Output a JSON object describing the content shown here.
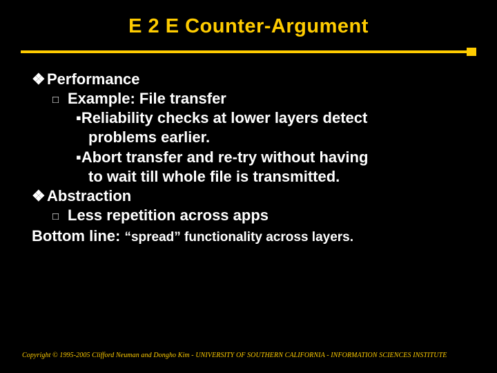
{
  "title": "E 2 E Counter-Argument",
  "items": {
    "performance": "Performance",
    "example": "Example: File transfer",
    "reliability1": "Reliability checks at lower layers detect",
    "reliability2": "problems earlier.",
    "abort1": "Abort transfer and re-try without having",
    "abort2": "to wait till whole file is transmitted.",
    "abstraction": "Abstraction",
    "less_rep": "Less repetition across apps"
  },
  "bottom": {
    "label": "Bottom line: ",
    "text": "“spread” functionality across layers."
  },
  "bullets": {
    "diamond": "❖",
    "square_outline": "□",
    "square_solid": "▪"
  },
  "copyright": "Copyright © 1995-2005 Clifford Neuman and Dongho Kim - UNIVERSITY OF SOUTHERN CALIFORNIA - INFORMATION SCIENCES INSTITUTE"
}
